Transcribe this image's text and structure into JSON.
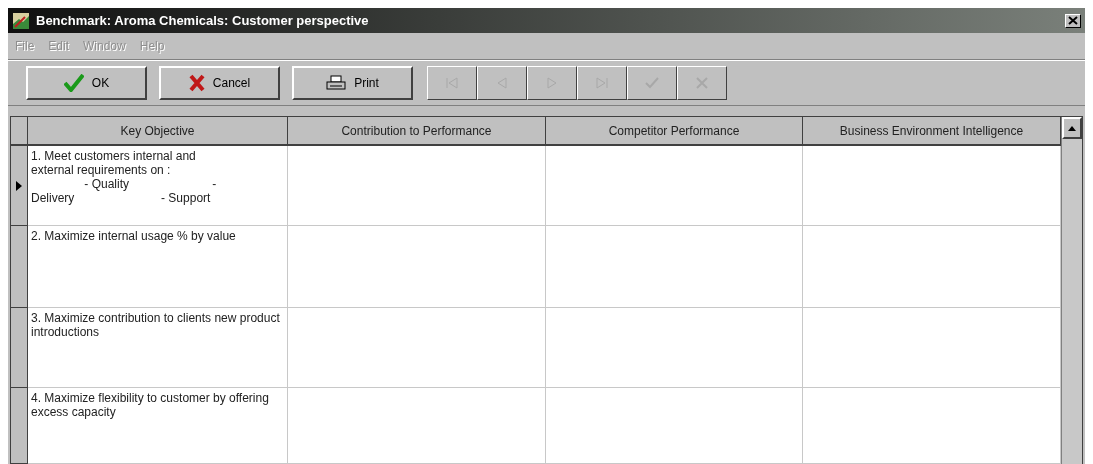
{
  "window": {
    "title": "Benchmark: Aroma Chemicals: Customer perspective"
  },
  "menu": [
    {
      "label": "File",
      "disabled": true
    },
    {
      "label": "Edit",
      "disabled": true
    },
    {
      "label": "Window",
      "disabled": true
    },
    {
      "label": "Help",
      "disabled": true
    }
  ],
  "toolbar": {
    "buttons": [
      {
        "kind": "ok",
        "label": "OK",
        "disabled": false
      },
      {
        "kind": "cancel",
        "label": "Cancel",
        "disabled": false
      },
      {
        "kind": "print",
        "label": "Print",
        "disabled": false
      }
    ],
    "navigator": [
      {
        "kind": "first",
        "disabled": true
      },
      {
        "kind": "prior",
        "disabled": true
      },
      {
        "kind": "next",
        "disabled": true
      },
      {
        "kind": "last",
        "disabled": true
      },
      {
        "kind": "post",
        "disabled": true
      },
      {
        "kind": "cancel",
        "disabled": true
      }
    ]
  },
  "table": {
    "columns": [
      "Key Objective",
      "Contribution to Performance",
      "Competitor Performance",
      "Business Environment Intelligence"
    ],
    "rows": [
      {
        "selected": true,
        "cells": [
          "1. Meet customers internal and\nexternal requirements on :\n                - Quality                         -\nDelivery                          - Support",
          "",
          "",
          ""
        ]
      },
      {
        "selected": false,
        "cells": [
          "2. Maximize internal usage % by value",
          "",
          "",
          ""
        ]
      },
      {
        "selected": false,
        "cells": [
          "3. Maximize contribution to clients new product introductions",
          "",
          "",
          ""
        ]
      },
      {
        "selected": false,
        "cells": [
          "4. Maximize flexibility to customer by offering excess capacity",
          "",
          "",
          ""
        ]
      }
    ]
  }
}
